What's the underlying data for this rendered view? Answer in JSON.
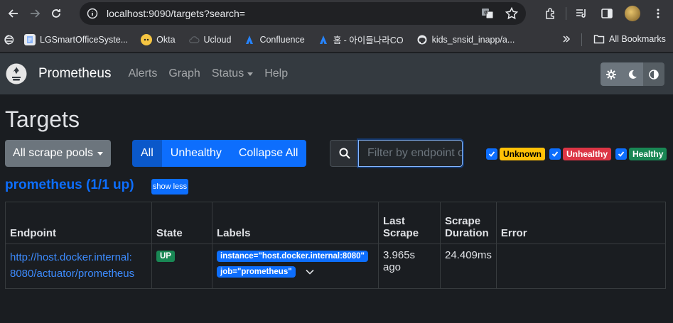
{
  "browser": {
    "url": "localhost:9090/targets?search=",
    "bookmarks": [
      {
        "label": "LGSmartOfficeSyste...",
        "icon": "document-icon",
        "color": "#8ab4f8"
      },
      {
        "label": "Okta",
        "icon": "okta-icon",
        "color": "#f5c542"
      },
      {
        "label": "Ucloud",
        "icon": "cloud-icon",
        "color": "#5f6368"
      },
      {
        "label": "Confluence",
        "icon": "confluence-icon",
        "color": "#2684ff"
      },
      {
        "label": "홈 - 아이들나라CO",
        "icon": "confluence-icon",
        "color": "#2684ff"
      },
      {
        "label": "kids_snsid_inapp/a...",
        "icon": "github-icon",
        "color": "#e8eaed"
      }
    ],
    "all_bookmarks": "All Bookmarks"
  },
  "nav": {
    "brand": "Prometheus",
    "links": [
      "Alerts",
      "Graph",
      "Status",
      "Help"
    ]
  },
  "page": {
    "title": "Targets",
    "pools_button": "All scrape pools",
    "filter_buttons": [
      "All",
      "Unhealthy",
      "Collapse All"
    ],
    "search_placeholder": "Filter by endpoint or labels",
    "health_filters": [
      {
        "label": "Unknown",
        "bg": "#ffc107",
        "fg": "#000"
      },
      {
        "label": "Unhealthy",
        "bg": "#dc3545",
        "fg": "#fff"
      },
      {
        "label": "Healthy",
        "bg": "#198754",
        "fg": "#fff"
      }
    ]
  },
  "pool": {
    "title": "prometheus (1/1 up)",
    "toggle": "show less",
    "columns": [
      "Endpoint",
      "State",
      "Labels",
      "Last Scrape",
      "Scrape Duration",
      "Error"
    ],
    "rows": [
      {
        "endpoint_line1": "http://host.docker.internal:",
        "endpoint_line2": "8080/actuator/prometheus",
        "state": "UP",
        "labels": [
          "instance=\"host.docker.internal:8080\"",
          "job=\"prometheus\""
        ],
        "last_scrape": "3.965s ago",
        "duration": "24.409ms",
        "error": ""
      }
    ]
  }
}
